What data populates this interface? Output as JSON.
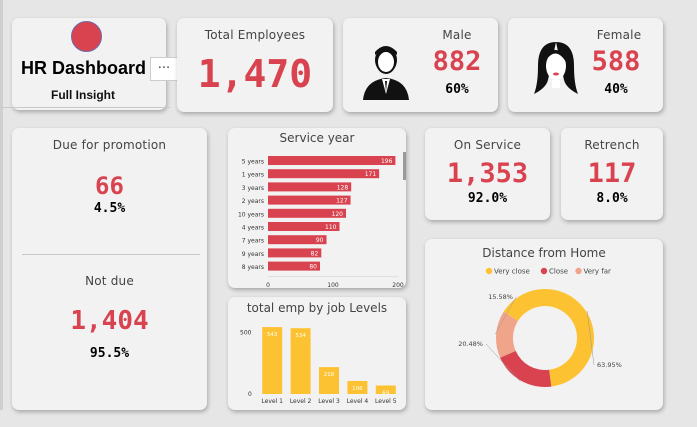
{
  "header": {
    "title": "HR Dashboard",
    "subtitle": "Full Insight",
    "more_label": "···"
  },
  "total": {
    "label": "Total Employees",
    "value": "1,470"
  },
  "male": {
    "label": "Male",
    "value": "882",
    "pct": "60%"
  },
  "female": {
    "label": "Female",
    "value": "588",
    "pct": "40%"
  },
  "promotion": {
    "due_label": "Due for promotion",
    "due_value": "66",
    "due_pct": "4.5%",
    "notdue_label": "Not due",
    "notdue_value": "1,404",
    "notdue_pct": "95.5%"
  },
  "onservice": {
    "label": "On Service",
    "value": "1,353",
    "pct": "92.0%"
  },
  "retrench": {
    "label": "Retrench",
    "value": "117",
    "pct": "8.0%"
  },
  "colors": {
    "accent": "#d9434f",
    "yellow": "#fdc232",
    "salmon": "#f0a48a",
    "card": "#f2f2f2"
  },
  "chart_data": [
    {
      "type": "bar",
      "orientation": "horizontal",
      "title": "Service year",
      "categories": [
        "5 years",
        "1 years",
        "3 years",
        "2 years",
        "10 years",
        "4 years",
        "7 years",
        "9 years",
        "8 years"
      ],
      "values": [
        196,
        171,
        128,
        127,
        120,
        110,
        90,
        82,
        80
      ],
      "xlim": [
        0,
        200
      ],
      "xticks": [
        "0",
        "100",
        "200"
      ],
      "color": "#d9434f"
    },
    {
      "type": "bar",
      "title": "total emp by job Levels",
      "categories": [
        "Level 1",
        "Level 2",
        "Level 3",
        "Level 4",
        "Level 5"
      ],
      "values": [
        543,
        534,
        218,
        106,
        69
      ],
      "ylim": [
        0,
        560
      ],
      "yticks": [
        "500",
        "0"
      ],
      "color": "#fdc232"
    },
    {
      "type": "pie",
      "donut": true,
      "title": "Distance from Home",
      "legend": [
        "Very close",
        "Close",
        "Very far"
      ],
      "legend_position": "top",
      "values": [
        63.95,
        20.48,
        15.58
      ],
      "labels": [
        "63.95%",
        "20.48%",
        "15.58%"
      ],
      "colors": [
        "#fdc232",
        "#d9434f",
        "#f0a48a"
      ]
    }
  ]
}
